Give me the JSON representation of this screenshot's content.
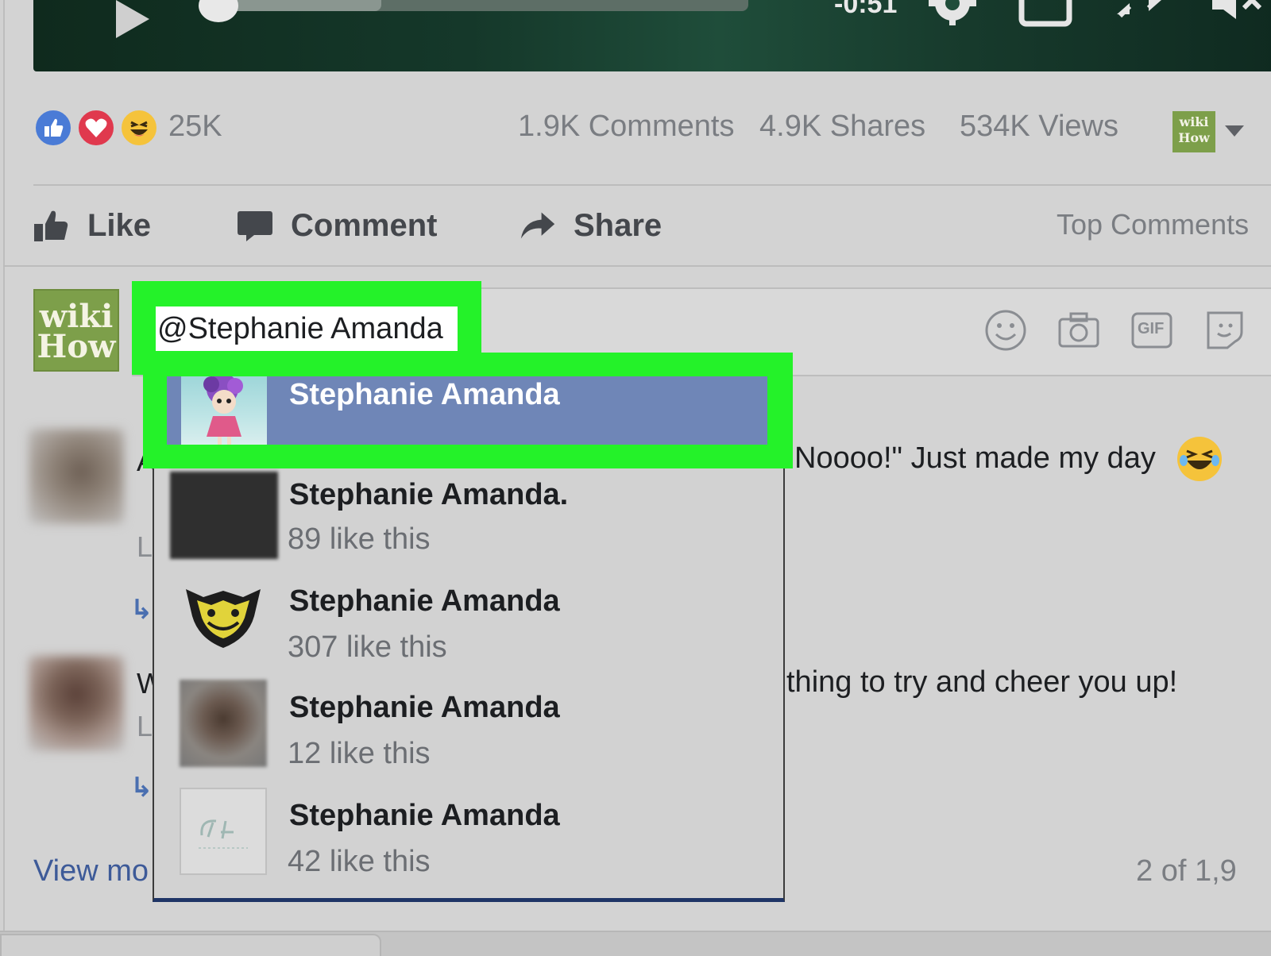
{
  "video": {
    "time_remaining": "-0:51",
    "progress_fraction": 0.33
  },
  "stats": {
    "reactions_count": "25K",
    "comments": "1.9K Comments",
    "shares": "4.9K Shares",
    "views": "534K Views",
    "page_logo_text": [
      "wiki",
      "How"
    ]
  },
  "actions": {
    "like_label": "Like",
    "comment_label": "Comment",
    "share_label": "Share",
    "sort_label": "Top Comments"
  },
  "composer": {
    "avatar_text": [
      "wiki",
      "How"
    ],
    "input_value": "@Stephanie Amanda",
    "icons": [
      "smiley-icon",
      "camera-icon",
      "gif-icon",
      "sticker-icon"
    ],
    "gif_text": "GIF"
  },
  "background_comments": {
    "comment1_text": "Noooo!\" Just made my day",
    "comment2_text": "thing to try and cheer you up!",
    "view_more": "View mo",
    "pager": "2 of 1,9"
  },
  "mention_suggestions": {
    "selected": {
      "name": "Stephanie Amanda"
    },
    "items": [
      {
        "name": "Stephanie Amanda.",
        "likes": "89 like this"
      },
      {
        "name": "Stephanie Amanda",
        "likes": "307 like this"
      },
      {
        "name": "Stephanie Amanda",
        "likes": "12 like this"
      },
      {
        "name": "Stephanie Amanda",
        "likes": "42 like this"
      }
    ]
  },
  "colors": {
    "highlight_green": "#24f229",
    "selected_row": "#6f86b7",
    "link_blue": "#3d5a98"
  }
}
